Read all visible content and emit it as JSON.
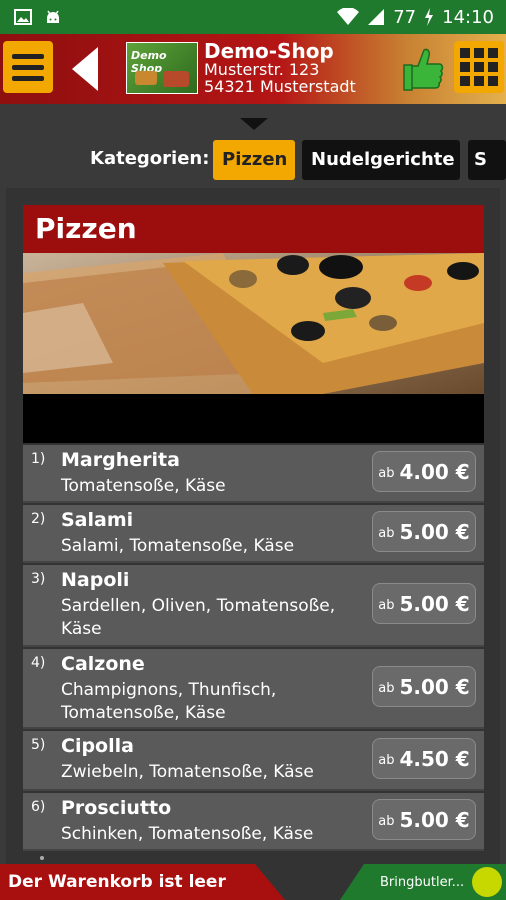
{
  "status_bar": {
    "battery_percent": "77",
    "time": "14:10"
  },
  "header": {
    "logo_text": "Demo Shop",
    "shop_name": "Demo-Shop",
    "address_line1": "Musterstr. 123",
    "address_line2": "54321 Musterstadt"
  },
  "categories": {
    "label": "Kategorien:",
    "tabs": [
      {
        "label": "Pizzen",
        "active": true
      },
      {
        "label": "Nudelgerichte",
        "active": false
      },
      {
        "label": "S",
        "active": false
      }
    ]
  },
  "section": {
    "title": "Pizzen"
  },
  "items": [
    {
      "num": "1)",
      "name": "Margherita",
      "desc": "Tomatensoße, Käse",
      "price_prefix": "ab",
      "price": "4.00 €"
    },
    {
      "num": "2)",
      "name": "Salami",
      "desc": "Salami, Tomatensoße, Käse",
      "price_prefix": "ab",
      "price": "5.00 €"
    },
    {
      "num": "3)",
      "name": "Napoli",
      "desc": "Sardellen, Oliven, Tomatensoße, Käse",
      "price_prefix": "ab",
      "price": "5.00 €"
    },
    {
      "num": "4)",
      "name": "Calzone",
      "desc": "Champignons, Thunfisch, Tomatensoße, Käse",
      "price_prefix": "ab",
      "price": "5.00 €"
    },
    {
      "num": "5)",
      "name": "Cipolla",
      "desc": "Zwiebeln, Tomatensoße, Käse",
      "price_prefix": "ab",
      "price": "4.50 €"
    },
    {
      "num": "6)",
      "name": "Prosciutto",
      "desc": "Schinken, Tomatensoße, Käse",
      "price_prefix": "ab",
      "price": "5.00 €"
    }
  ],
  "footer": {
    "cart_text": "Der Warenkorb ist leer",
    "brand_text": "Bringbutler..."
  },
  "colors": {
    "accent": "#f2a800",
    "header_red": "#b51515",
    "section_red": "#9c0d0d",
    "status_green": "#1f7a2e"
  }
}
